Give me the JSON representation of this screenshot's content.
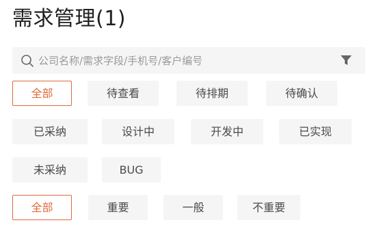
{
  "page": {
    "title": "需求管理(1)"
  },
  "search": {
    "placeholder": "公司名称/需求字段/手机号/客户编号",
    "value": ""
  },
  "status_filters": [
    {
      "label": "全部",
      "active": true
    },
    {
      "label": "待查看",
      "active": false
    },
    {
      "label": "待排期",
      "active": false
    },
    {
      "label": "待确认",
      "active": false
    },
    {
      "label": "已采纳",
      "active": false
    },
    {
      "label": "设计中",
      "active": false
    },
    {
      "label": "开发中",
      "active": false
    },
    {
      "label": "已实现",
      "active": false
    },
    {
      "label": "未采纳",
      "active": false
    },
    {
      "label": "BUG",
      "active": false
    }
  ],
  "priority_filters": [
    {
      "label": "全部",
      "active": true
    },
    {
      "label": "重要",
      "active": false
    },
    {
      "label": "一般",
      "active": false
    },
    {
      "label": "不重要",
      "active": false
    }
  ],
  "colors": {
    "accent": "#e06a3b",
    "tag_bg": "#f5f5f5",
    "text": "#1f1f1f"
  }
}
